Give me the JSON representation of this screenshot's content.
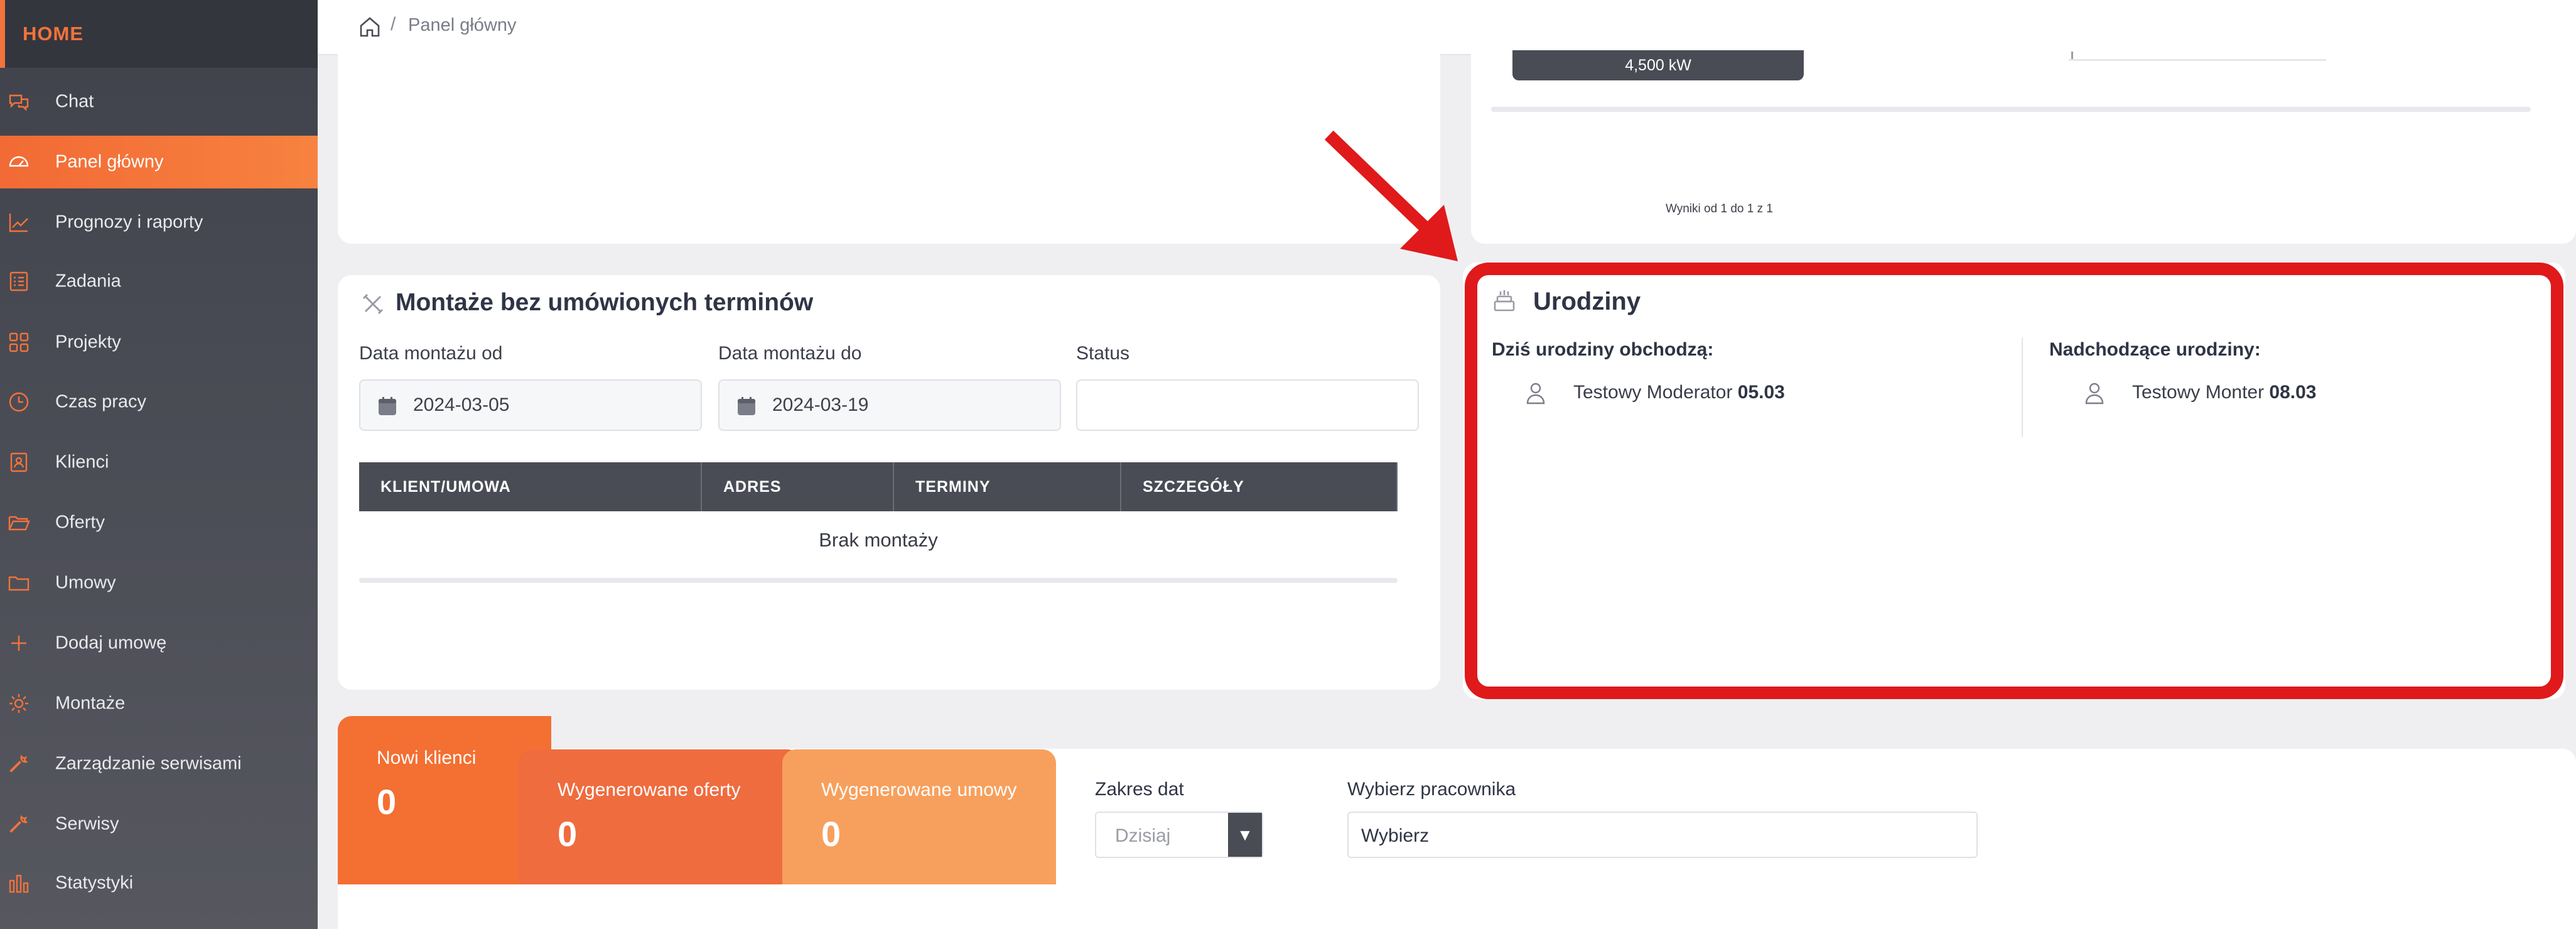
{
  "sidebar": {
    "home": "HOME",
    "items": [
      {
        "label": "Chat",
        "icon": "chat-icon"
      },
      {
        "label": "Panel główny",
        "icon": "dashboard-icon"
      },
      {
        "label": "Prognozy i raporty",
        "icon": "chart-line-icon"
      },
      {
        "label": "Zadania",
        "icon": "task-list-icon"
      },
      {
        "label": "Projekty",
        "icon": "grid-icon"
      },
      {
        "label": "Czas pracy",
        "icon": "clock-icon"
      },
      {
        "label": "Klienci",
        "icon": "address-book-icon"
      },
      {
        "label": "Oferty",
        "icon": "folder-open-icon"
      },
      {
        "label": "Umowy",
        "icon": "folder-icon"
      },
      {
        "label": "Dodaj umowę",
        "icon": "plus-icon"
      },
      {
        "label": "Montaże",
        "icon": "sun-icon"
      },
      {
        "label": "Zarządzanie serwisami",
        "icon": "wrench-icon"
      },
      {
        "label": "Serwisy",
        "icon": "wrench-icon"
      },
      {
        "label": "Statystyki",
        "icon": "bar-chart-icon"
      }
    ],
    "accent": "#f2733b"
  },
  "breadcrumb": {
    "separator": "/",
    "current": "Panel główny"
  },
  "top_right": {
    "power_value": "4,500 kW",
    "results": "Wyniki od 1 do 1 z 1"
  },
  "montaze": {
    "title": "Montaże bez umówionych terminów",
    "date_from_label": "Data montażu od",
    "date_from_value": "2024-03-05",
    "date_to_label": "Data montażu do",
    "date_to_value": "2024-03-19",
    "status_label": "Status",
    "status_value": "",
    "columns": [
      "KLIENT/UMOWA",
      "ADRES",
      "TERMINY",
      "SZCZEGÓŁY"
    ],
    "empty": "Brak montaży"
  },
  "urodziny": {
    "title": "Urodziny",
    "today_label": "Dziś urodziny obchodzą:",
    "today_name": "Testowy Moderator",
    "today_date": "05.03",
    "upcoming_label": "Nadchodzące urodziny:",
    "upcoming_name": "Testowy Monter",
    "upcoming_date": "08.03"
  },
  "stats": {
    "tabs": [
      {
        "label": "Nowi klienci",
        "value": "0",
        "color": "#f46f32"
      },
      {
        "label": "Wygenerowane oferty",
        "value": "0",
        "color": "#ef6c3f"
      },
      {
        "label": "Wygenerowane umowy",
        "value": "0",
        "color": "#f7a05d"
      }
    ],
    "date_range_label": "Zakres dat",
    "date_range_value": "Dzisiaj",
    "employee_label": "Wybierz pracownika",
    "employee_value": "Wybierz"
  },
  "highlight_color": "#e0191b"
}
